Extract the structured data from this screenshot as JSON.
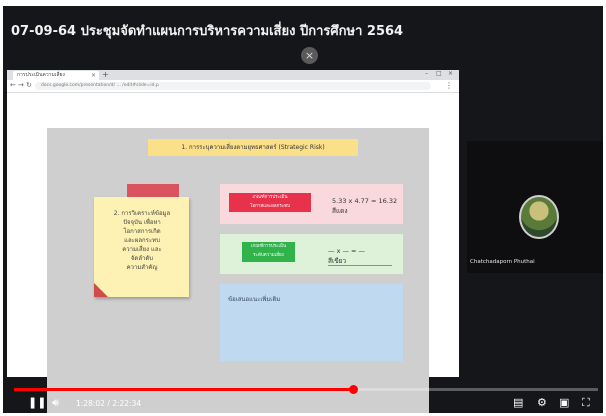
{
  "video": {
    "title": "07-09-64 ประชุมจัดทำแผนการบริหารความเสี่ยง ปีการศึกษา 2564",
    "close_glyph": "×",
    "time_display": "1:28:02 / 2:22:34",
    "progress_fraction": 0.58,
    "accent_color": "#ff0000"
  },
  "browser": {
    "tab_label": "การประเมินความเสี่ยง",
    "tab_close": "×",
    "new_tab": "+",
    "window_controls": [
      "–",
      "□",
      "×"
    ],
    "back": "←",
    "forward": "→",
    "reload": "↻",
    "url": "docs.google.com/presentation/d/ ... /edit#slide=id.p",
    "menu": "⋮"
  },
  "slide": {
    "title": "1. การระบุความเสี่ยงตามยุทธศาสตร์ (Strategic Risk)",
    "note_text": "2. การวิเคราะห์ข้อมูล\nปัจจุบัน เพื่อหา\nโอกาสการเกิด\nและผลกระทบ\nความเสี่ยง และ\nจัดลำดับ\nความสำคัญ",
    "pink_button": "เกณฑ์การประเมิน\nโอกาสและผลกระทบ",
    "pink_value": "5.33 x 4.77 = 16.32\nสีแดง",
    "green_button": "เกณฑ์การประเมิน\nระดับความเสี่ยง",
    "green_value": "— x — = —\nสีเขียว",
    "blue_label": "ข้อเสนอแนะเพิ่มเติม"
  },
  "participant": {
    "name": "Chatchadaporn Phuthai"
  }
}
